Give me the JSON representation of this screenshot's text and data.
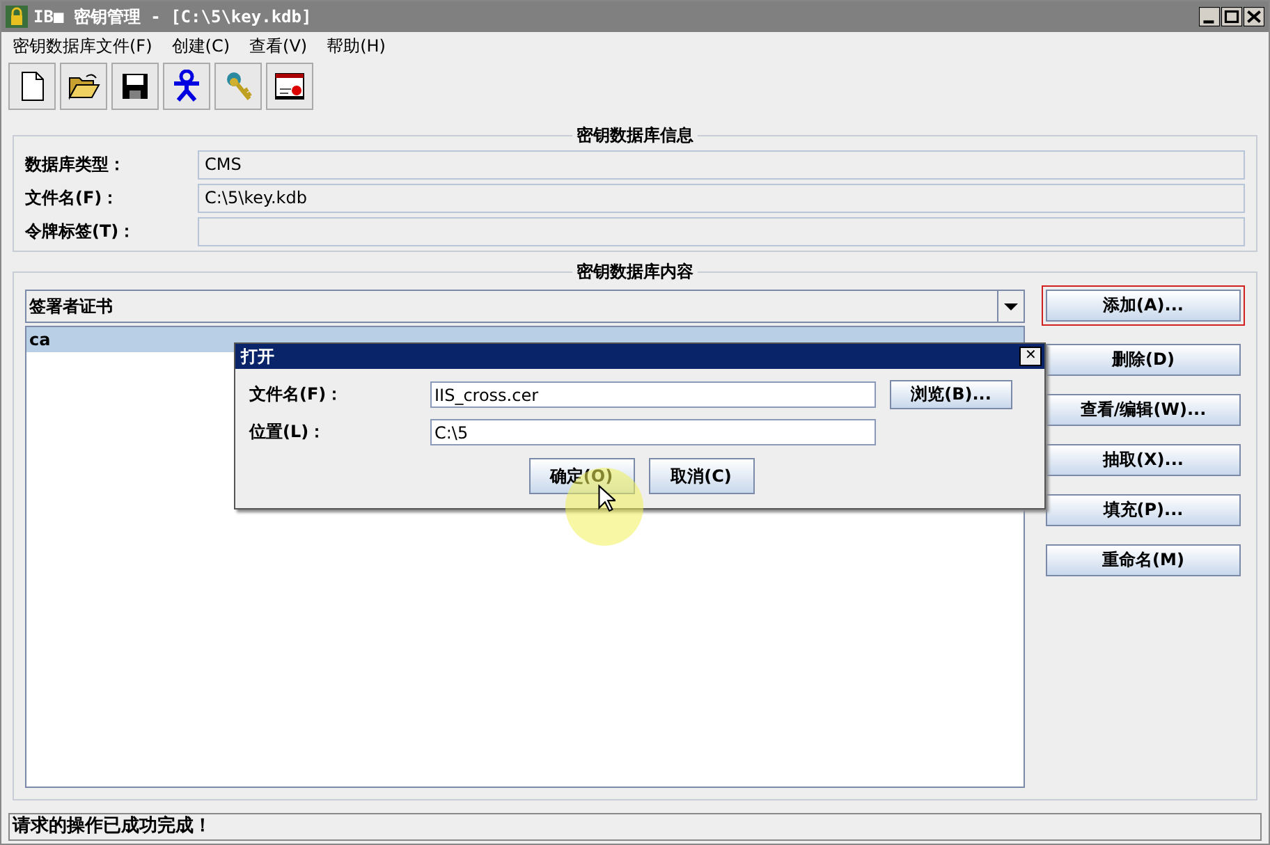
{
  "window": {
    "title": "IB■ 密钥管理 - [C:\\5\\key.kdb]"
  },
  "menu": [
    "密钥数据库文件(F)",
    "创建(C)",
    "查看(V)",
    "帮助(H)"
  ],
  "toolbar": [
    {
      "kind": "new"
    },
    {
      "kind": "open"
    },
    {
      "kind": "save"
    },
    {
      "kind": "person"
    },
    {
      "kind": "key"
    },
    {
      "kind": "certificate"
    }
  ],
  "info_panel": {
    "title": "密钥数据库信息",
    "fields": [
      {
        "label": "数据库类型：",
        "value": "CMS"
      },
      {
        "label": "文件名(F)：",
        "value": "C:\\5\\key.kdb"
      },
      {
        "label": "令牌标签(T)："
      }
    ]
  },
  "content_panel": {
    "title": "密钥数据库内容",
    "dropdown": "签署者证书",
    "list": [
      {
        "label": "ca",
        "selected": true
      }
    ],
    "buttons": [
      {
        "label": "添加(A)...",
        "focused": true
      },
      {
        "label": "删除(D)",
        "focused": false
      },
      {
        "label": "查看/编辑(W)...",
        "focused": false
      },
      {
        "label": "抽取(X)...",
        "focused": false
      },
      {
        "label": "填充(P)...",
        "focused": false
      },
      {
        "label": "重命名(M)",
        "focused": false
      }
    ]
  },
  "dialog": {
    "title": "打开",
    "close": "✕",
    "fields": [
      {
        "label": "文件名(F)：",
        "value": "IIS_cross.cer"
      },
      {
        "label": "位置(L)：",
        "value": "C:\\5"
      }
    ],
    "browse": "浏览(B)...",
    "buttons": [
      "确定(O)",
      "取消(C)"
    ]
  },
  "status_bar": "请求的操作已成功完成！"
}
